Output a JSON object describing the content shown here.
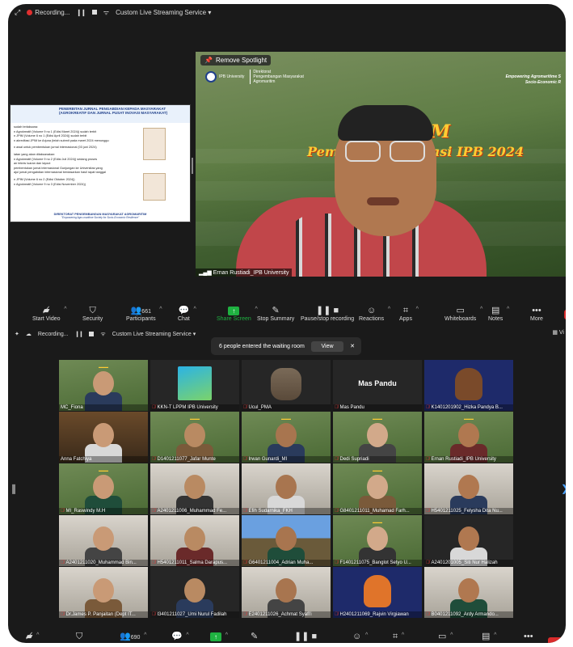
{
  "top_bar": {
    "recording_label": "Recording...",
    "stream_label": "Custom Live Streaming Service"
  },
  "shared_screen": {
    "title_line1": "PENERBITAN JURNAL PENGABDIAN KEPADA MASYARAKAT",
    "title_line2": "(AGROKREATIF DAN JURNAL PUSAT INOVASI MASYARAKAT)",
    "lines": [
      "sudah terlaksana:",
      "n Agrokreatif (Volume 9 no 1 (Edisi Maret 2024)) sudah terbit",
      "n JPIM (Volume 6 no 1 (Edisi April 2024)) sudah terbit",
      "n akreditasi JPIM ke Arjuna (telah submit pada maret 2024 menunggu",
      "",
      "n awal untuk pembentukan jurnal internasional (03 juni 2024)",
      "",
      "iatan yang akan dilaksanakan:",
      "n Agrokreatif (Volume 9 no 2 (Edisi Juli 2024)) sedang proses",
      "an teknis luaran dan layout",
      "pembentukan jurnal internasional Gunjungan ke Universitas yang",
      "ajul jurnal pengabdian internasional berdasarkan hasil rapat tanggal",
      "",
      "n JPIM (Volume 6 no 2 (Edisi Oktober 2024))",
      "n Agrokreatif (Volume 9 no 3 (Edisi November 2024))"
    ],
    "footer_line1": "DIREKTORAT PENGEMBANGAN MASYARAKAT AGROMARITIM",
    "footer_line2": "\"Empowering Agro-maritime Society for Socio-Economic Resilience\""
  },
  "spotlight": {
    "remove_label": "Remove Spotlight",
    "ipb_name": "IPB University",
    "org_lines": [
      "Direktorat",
      "Pengembangan Masyarakat",
      "Agromaritim"
    ],
    "tagline_line1": "Empowering Agromaritime S",
    "tagline_line2": "Socio-Economic R",
    "banner_line1": "UMUM",
    "banner_line2": "Pemb             novasi IPB 2024",
    "speaker_name": "Ernan Rustiadi_IPB University"
  },
  "toolbar": {
    "items": [
      {
        "key": "start_video",
        "label": "Start Video",
        "icon": "video-off-icon"
      },
      {
        "key": "security",
        "label": "Security",
        "icon": "shield-icon"
      },
      {
        "key": "participants",
        "label": "Participants",
        "icon": "participants-icon",
        "count": "661"
      },
      {
        "key": "chat",
        "label": "Chat",
        "icon": "chat-icon"
      },
      {
        "key": "share",
        "label": "Share Screen",
        "icon": "share-screen-icon"
      },
      {
        "key": "summary",
        "label": "Stop Summary",
        "icon": "summary-icon"
      },
      {
        "key": "record",
        "label": "Pause/stop recording",
        "icon": "record-controls-icon"
      },
      {
        "key": "reactions",
        "label": "Reactions",
        "icon": "reactions-icon"
      },
      {
        "key": "apps",
        "label": "Apps",
        "icon": "apps-icon"
      },
      {
        "key": "whiteboards",
        "label": "Whiteboards",
        "icon": "whiteboard-icon"
      },
      {
        "key": "notes",
        "label": "Notes",
        "icon": "notes-icon"
      },
      {
        "key": "more",
        "label": "More",
        "icon": "more-icon"
      }
    ]
  },
  "second_window": {
    "recording_label": "Recording...",
    "stream_label": "Custom Live Streaming Service",
    "view_label": "Vi",
    "toast_text": "6 people entered the waiting room",
    "toast_button": "View",
    "participants_count": "690"
  },
  "gallery": [
    {
      "name": "MC_Fiona",
      "muted": false,
      "kind": "banner"
    },
    {
      "name": "KKN-T LPPM IPB University",
      "muted": true,
      "kind": "poster"
    },
    {
      "name": "Ucul_PMA",
      "muted": true,
      "kind": "elephant"
    },
    {
      "name": "Mas Pandu",
      "muted": true,
      "kind": "name",
      "big_name": "Mas Pandu"
    },
    {
      "name": "K1401201902_Hizka Pandya B...",
      "muted": true,
      "kind": "avatar"
    },
    {
      "name": "Anna Fatchiya",
      "muted": false,
      "kind": "building"
    },
    {
      "name": "D1401211077_Jafar Munte",
      "muted": true,
      "kind": "banner"
    },
    {
      "name": "Irwan Gunardi_MI",
      "muted": true,
      "kind": "banner"
    },
    {
      "name": "Dedi Supriadi",
      "muted": true,
      "kind": "banner"
    },
    {
      "name": "Ernan Rustiadi_IPB University",
      "muted": true,
      "kind": "banner"
    },
    {
      "name": "MI_Raswindy M.H",
      "muted": true,
      "kind": "banner"
    },
    {
      "name": "A2401211006_Muhammad Fe...",
      "muted": true,
      "kind": "room"
    },
    {
      "name": "Efih Sudarnika_FKH",
      "muted": true,
      "kind": "room"
    },
    {
      "name": "G8401211011_Muhamad Farh...",
      "muted": true,
      "kind": "banner"
    },
    {
      "name": "H5401211025_Felysha Dita Nu...",
      "muted": true,
      "kind": "room"
    },
    {
      "name": "A2401211020_Muhammad Bin...",
      "muted": true,
      "kind": "room"
    },
    {
      "name": "H5401211011_Salma Darapus...",
      "muted": true,
      "kind": "room"
    },
    {
      "name": "G6401211004_Adrian Muha...",
      "muted": true,
      "kind": "minecraft"
    },
    {
      "name": "F1401211075_Banglot Setyo U...",
      "muted": true,
      "kind": "banner"
    },
    {
      "name": "A2401201005_Siti Nur Halizah",
      "muted": true,
      "kind": "dark"
    },
    {
      "name": "Dr.James P. Panjaitan (Dept IT...",
      "muted": true,
      "kind": "room"
    },
    {
      "name": "I3401211027_Umi Nurul Fadilah",
      "muted": true,
      "kind": "dark"
    },
    {
      "name": "E2401211026_Achmat Syafi'i",
      "muted": true,
      "kind": "room"
    },
    {
      "name": "H2401211069_Rajvin Virgiawan",
      "muted": true,
      "kind": "fox"
    },
    {
      "name": "B0401211092_Ardy Armando...",
      "muted": true,
      "kind": "room"
    }
  ]
}
